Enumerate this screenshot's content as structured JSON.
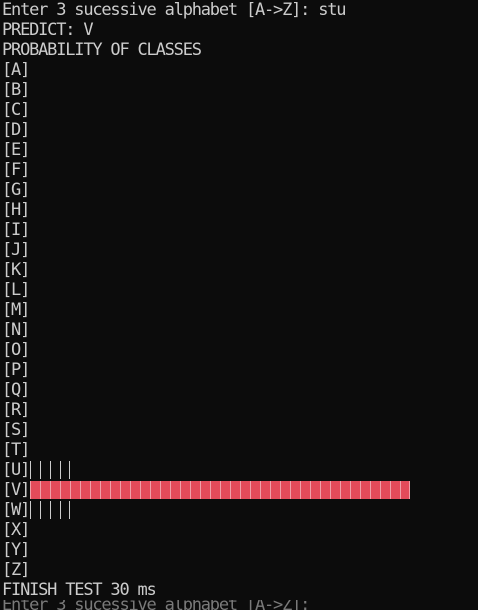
{
  "terminal": {
    "prompt_line": "Enter 3 sucessive alphabet [A->Z]: stu",
    "predict_line": "PREDICT: V",
    "heading_line": "PROBABILITY OF CLASSES",
    "footer_line": "FINISH TEST 30 ms",
    "partial_line": "Enter 3 sucessive alphabet [A->Z]:",
    "colors": {
      "background": "#0c0c0c",
      "text": "#cccccc",
      "highlight": "#e34b5a"
    }
  },
  "classes": [
    {
      "label": "[A]",
      "ticks": 0
    },
    {
      "label": "[B]",
      "ticks": 0
    },
    {
      "label": "[C]",
      "ticks": 0
    },
    {
      "label": "[D]",
      "ticks": 0
    },
    {
      "label": "[E]",
      "ticks": 0
    },
    {
      "label": "[F]",
      "ticks": 0
    },
    {
      "label": "[G]",
      "ticks": 0
    },
    {
      "label": "[H]",
      "ticks": 0
    },
    {
      "label": "[I]",
      "ticks": 0
    },
    {
      "label": "[J]",
      "ticks": 0
    },
    {
      "label": "[K]",
      "ticks": 0
    },
    {
      "label": "[L]",
      "ticks": 0
    },
    {
      "label": "[M]",
      "ticks": 0
    },
    {
      "label": "[N]",
      "ticks": 0
    },
    {
      "label": "[O]",
      "ticks": 0
    },
    {
      "label": "[P]",
      "ticks": 0
    },
    {
      "label": "[Q]",
      "ticks": 0
    },
    {
      "label": "[R]",
      "ticks": 0
    },
    {
      "label": "[S]",
      "ticks": 0
    },
    {
      "label": "[T]",
      "ticks": 0
    },
    {
      "label": "[U]",
      "ticks": 4,
      "active": false
    },
    {
      "label": "[V]",
      "ticks": 38,
      "active": true
    },
    {
      "label": "[W]",
      "ticks": 4,
      "active": false
    },
    {
      "label": "[X]",
      "ticks": 0
    },
    {
      "label": "[Y]",
      "ticks": 0
    },
    {
      "label": "[Z]",
      "ticks": 0
    }
  ]
}
